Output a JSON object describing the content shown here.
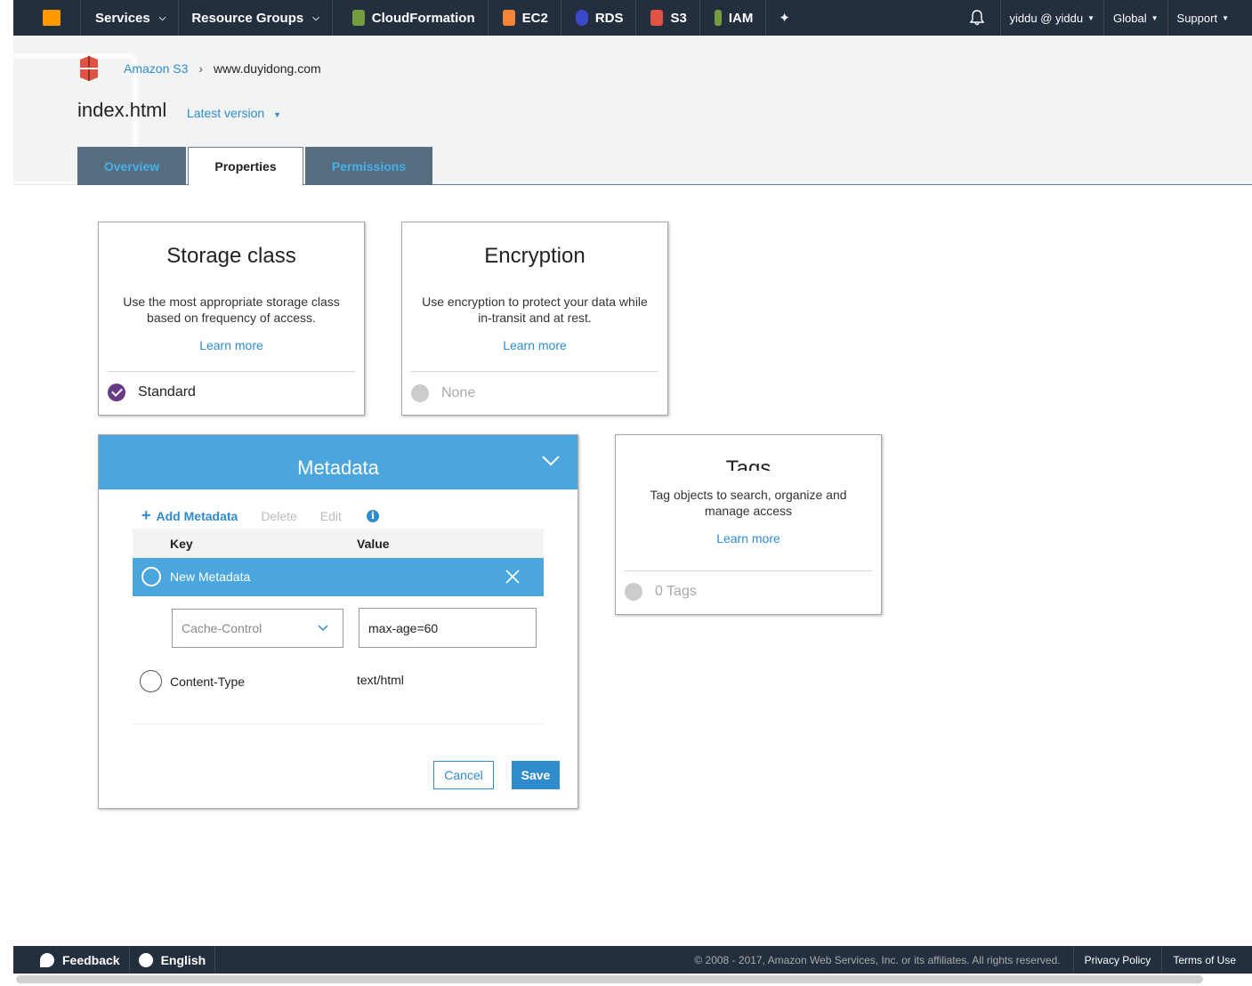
{
  "nav": {
    "services": "Services",
    "resource_groups": "Resource Groups",
    "links": [
      {
        "label": "CloudFormation",
        "icon": "cloudformation-icon",
        "color": "#759c3e"
      },
      {
        "label": "EC2",
        "icon": "ec2-icon",
        "color": "#f58536"
      },
      {
        "label": "RDS",
        "icon": "rds-icon",
        "color": "#3b48cc"
      },
      {
        "label": "S3",
        "icon": "s3-icon",
        "color": "#e05243"
      },
      {
        "label": "IAM",
        "icon": "iam-icon",
        "color": "#759c3e"
      }
    ],
    "user": "yiddu @ yiddu",
    "region": "Global",
    "support": "Support"
  },
  "breadcrumb": {
    "root": "Amazon S3",
    "bucket": "www.duyidong.com"
  },
  "object": {
    "name": "index.html",
    "version": "Latest version"
  },
  "tabs": [
    {
      "label": "Overview"
    },
    {
      "label": "Properties"
    },
    {
      "label": "Permissions"
    }
  ],
  "storage": {
    "title": "Storage class",
    "desc": "Use the most appropriate storage class based on frequency of access.",
    "learn": "Learn more",
    "value": "Standard"
  },
  "encryption": {
    "title": "Encryption",
    "desc": "Use encryption to protect your data while in-transit and at rest.",
    "learn": "Learn more",
    "value": "None"
  },
  "tags": {
    "title": "Tags",
    "desc": "Tag objects to search, organize and manage access",
    "learn": "Learn more",
    "value": "0 Tags"
  },
  "metadata": {
    "title": "Metadata",
    "add": "Add Metadata",
    "delete": "Delete",
    "edit": "Edit",
    "col_key": "Key",
    "col_value": "Value",
    "new_row": "New Metadata",
    "key_placeholder": "Cache-Control",
    "value_input": "max-age=60",
    "existing_key": "Content-Type",
    "existing_value": "text/html",
    "cancel": "Cancel",
    "save": "Save"
  },
  "footer": {
    "feedback": "Feedback",
    "language": "English",
    "copyright": "© 2008 - 2017, Amazon Web Services, Inc. or its affiliates. All rights reserved.",
    "privacy": "Privacy Policy",
    "terms": "Terms of Use"
  }
}
